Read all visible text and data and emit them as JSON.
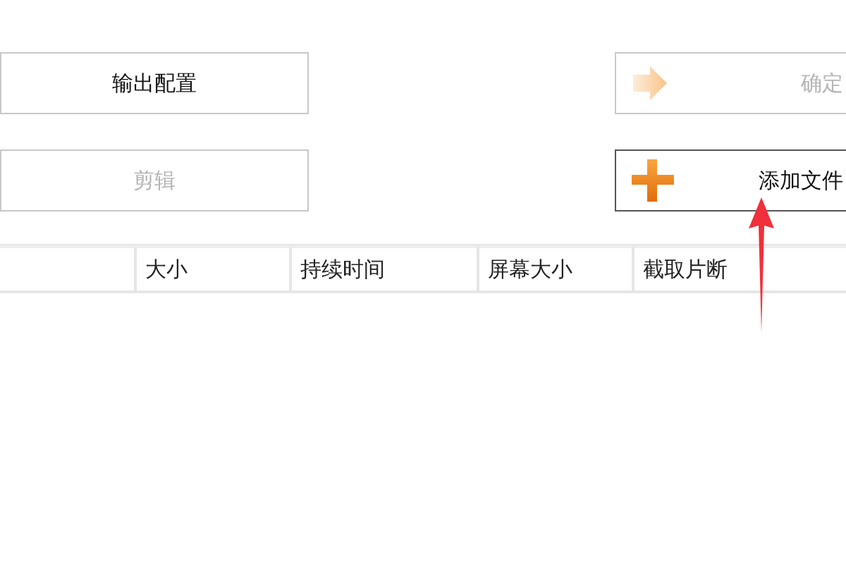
{
  "buttons": [
    {
      "label": "输出配置",
      "disabled": false,
      "focused": false,
      "kind": "plain"
    },
    {
      "label": "确定",
      "disabled": true,
      "focused": false,
      "kind": "arrow"
    },
    {
      "label": "剪辑",
      "disabled": true,
      "focused": false,
      "kind": "plain"
    },
    {
      "label": "添加文件",
      "disabled": false,
      "focused": true,
      "kind": "plus"
    }
  ],
  "table": {
    "columns": [
      "大小",
      "持续时间",
      "屏幕大小",
      "截取片断"
    ]
  }
}
